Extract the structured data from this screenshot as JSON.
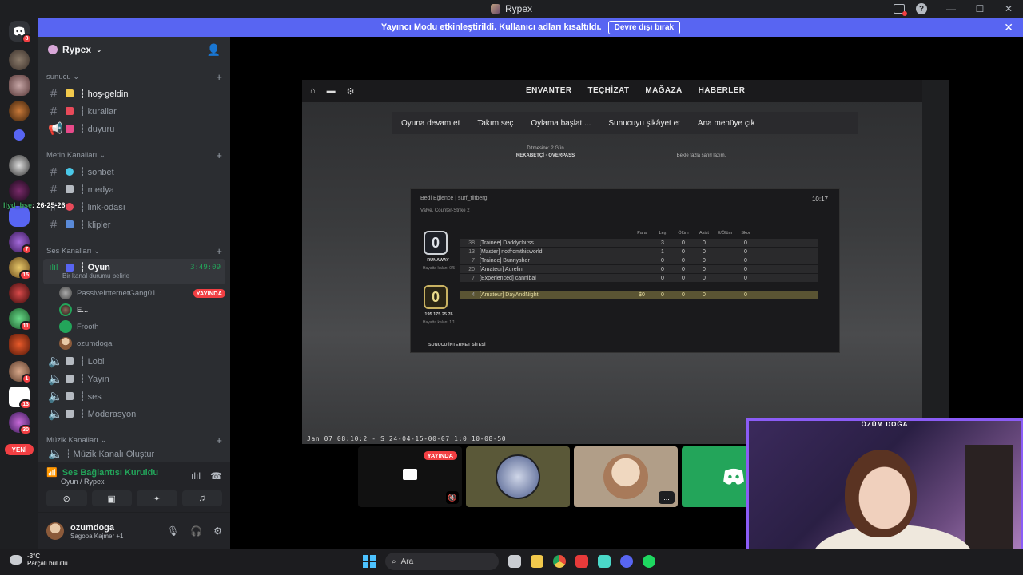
{
  "window": {
    "title": "Rypex"
  },
  "banner": {
    "text": "Yayıncı Modu etkinleştirildi. Kullanıcı adları kısaltıldı.",
    "button": "Devre dışı bırak"
  },
  "guild_badges": {
    "dm": "8",
    "g7": "7",
    "g15": "15",
    "g11": "11",
    "g1": "1",
    "g13": "13",
    "g30": "30",
    "yeni": "YENİ"
  },
  "overlay_ping": {
    "name": "llyd_bse",
    "value": ": 26-25-26"
  },
  "server": {
    "name": "Rypex"
  },
  "categories": [
    {
      "name": "sunucu"
    },
    {
      "name": "Metin Kanalları"
    },
    {
      "name": "Ses Kanalları"
    },
    {
      "name": "Müzik Kanalları"
    }
  ],
  "channels": {
    "welcome": "┆ hoş-geldin",
    "rules": "┆ kurallar",
    "announce": "┆ duyuru",
    "chat": "┆ sohbet",
    "media": "┆ medya",
    "links": "┆ link-odası",
    "clips": "┆ klipler",
    "voice_oyun": "┆ Oyun",
    "voice_oyun_time": "3:49:09",
    "voice_oyun_status": "Bir kanal durumu belirle",
    "lobi": "┆ Lobi",
    "yayin": "┆ Yayın",
    "ses": "┆ ses",
    "moderasyon": "┆ Moderasyon",
    "music_create": "┆ Müzik Kanalı Oluştur"
  },
  "voice_users": [
    {
      "name": "PassiveInternetGang01",
      "live": "YAYINDA"
    },
    {
      "name": "E..."
    },
    {
      "name": "Frooth"
    },
    {
      "name": "ozumdoga"
    }
  ],
  "voice_panel": {
    "status": "Ses Bağlantısı Kuruldu",
    "sub": "Oyun / Rypex"
  },
  "user": {
    "name": "ozumdoga",
    "status": "Sagopa Kajmer +1"
  },
  "game": {
    "nav": [
      "ENVANTER",
      "TEÇHİZAT",
      "MAĞAZA",
      "HABERLER"
    ],
    "pause": [
      "Oyuna devam et",
      "Takım seç",
      "Oylama başlat ...",
      "Sunucuyu şikâyet et",
      "Ana menüye çık"
    ],
    "match_label": "Ditmesine: 2 Gün",
    "match_map": "REKABETÇİ · OVERPASS",
    "match_right": "Bekle fazla sanrl lazım.",
    "scoreboard_title": "Bedi Eğlence | surf_tiltberg",
    "scoreboard_time": "10:17",
    "scoreboard_sub": "Valve, Counter-Strike 2",
    "headers": [
      "Para",
      "Leş",
      "Ölüm",
      "Asist",
      "E/Ölüm",
      "Skor"
    ],
    "rows": [
      {
        "num": "38",
        "name": "[Trainee] Daddychirss",
        "stats": [
          "",
          "3",
          "0",
          "0",
          "",
          "0"
        ]
      },
      {
        "num": "13",
        "name": "[Master] notfromthisworld",
        "stats": [
          "",
          "1",
          "0",
          "0",
          "",
          "0"
        ]
      },
      {
        "num": "7",
        "name": "[Trainee] Bunnysher",
        "stats": [
          "",
          "0",
          "0",
          "0",
          "",
          "0"
        ]
      },
      {
        "num": "20",
        "name": "[Amateur] Aurelin",
        "stats": [
          "",
          "0",
          "0",
          "0",
          "",
          "0"
        ]
      },
      {
        "num": "7",
        "name": "[Experienced] cannibal",
        "stats": [
          "",
          "0",
          "0",
          "0",
          "",
          "0"
        ]
      }
    ],
    "self_row": {
      "num": "4",
      "name": "[Amateur] DayAndNight",
      "stats": [
        "$0",
        "0",
        "0",
        "0",
        "",
        "0"
      ]
    },
    "team1_score": "0",
    "team1_name": "RUNAWAY",
    "team1_sub": "Hayatta kalan: 0/5",
    "team2_score": "0",
    "team2_name": "195.175.25.76",
    "team2_sub": "Hayatta kalan: 1/1",
    "footer": "SUNUCU İNTERNET SİTESİ",
    "timestamp": "Jan 07 08:10:2 - S 24-04-15-00-07 1:0 10-08-50"
  },
  "thumbs": {
    "live": "YAYINDA",
    "more": "..."
  },
  "webcam": {
    "label": "ÖZÜM DOĞA"
  },
  "taskbar": {
    "temp": "-3°C",
    "weather": "Parçalı bulutlu",
    "search": "Ara"
  }
}
